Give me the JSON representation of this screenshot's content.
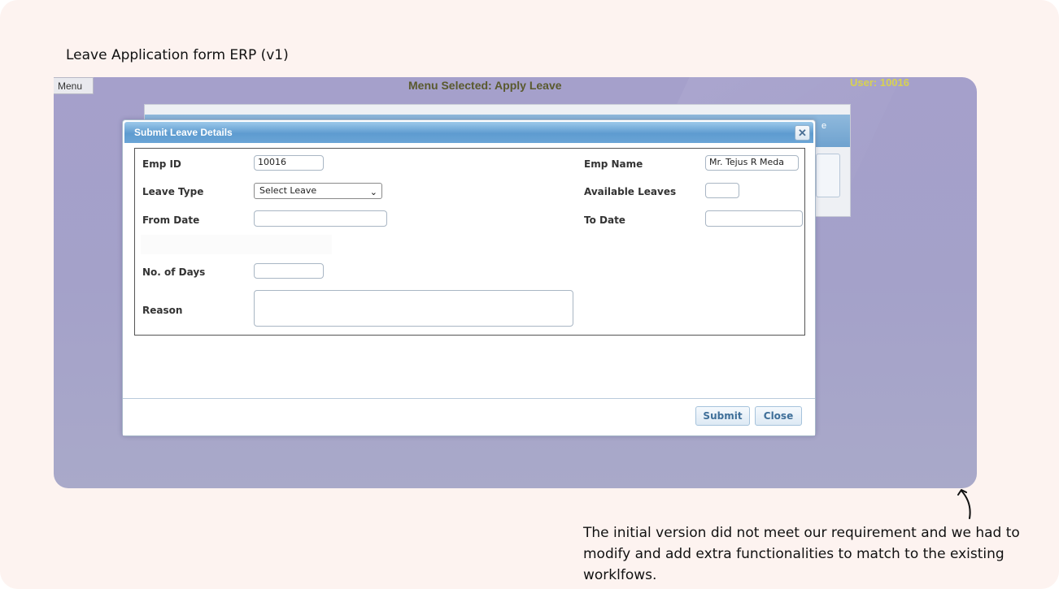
{
  "caption": {
    "title": "Leave Application form ERP (v1)",
    "note": "The initial version did not meet our requirement and we had to modify and add extra functionalities to match to the existing worklfows."
  },
  "app": {
    "menu_button": "Menu",
    "menu_selected": "Menu Selected: Apply Leave",
    "user": "User: 10016",
    "background_table_header_fragment": "e"
  },
  "dialog": {
    "title": "Submit Leave Details",
    "close_icon": "close-icon",
    "fields": {
      "emp_id": {
        "label": "Emp ID",
        "value": "10016"
      },
      "emp_name": {
        "label": "Emp Name",
        "value": "Mr. Tejus R Meda"
      },
      "leave_type": {
        "label": "Leave Type",
        "selected": "Select Leave"
      },
      "available_leaves": {
        "label": "Available Leaves",
        "value": ""
      },
      "from_date": {
        "label": "From Date",
        "value": ""
      },
      "to_date": {
        "label": "To Date",
        "value": ""
      },
      "no_of_days": {
        "label": "No. of Days",
        "value": ""
      },
      "reason": {
        "label": "Reason",
        "value": ""
      }
    },
    "buttons": {
      "submit": "Submit",
      "close": "Close"
    }
  },
  "colors": {
    "page_bg": "#fdf3f0",
    "app_bg": "#a5a0cb",
    "titlebar": "#5e9bd0",
    "user_text": "#d8d250",
    "menu_selected_text": "#5a5a2e"
  }
}
